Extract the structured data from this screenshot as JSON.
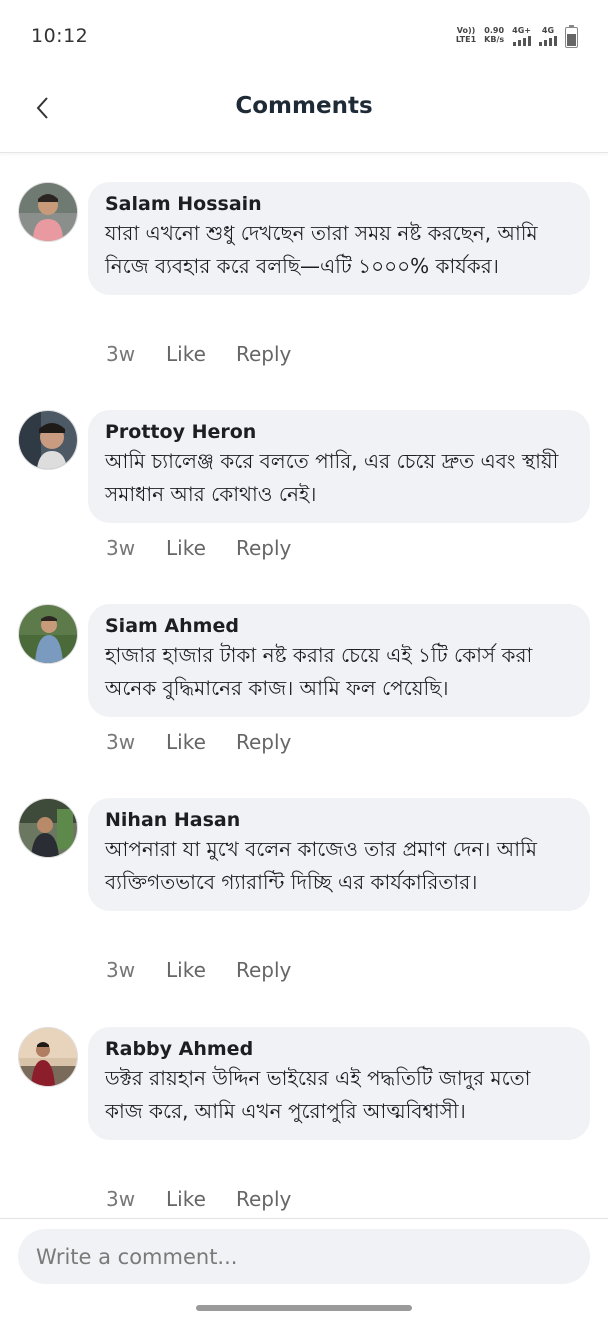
{
  "status_bar": {
    "time": "10:12",
    "volte_top": "Vo))",
    "volte_bottom": "LTE1",
    "speed_value": "0.90",
    "speed_unit": "KB/s",
    "network1": "4G+",
    "network2": "4G"
  },
  "header": {
    "title": "Comments",
    "back_icon": "chevron-left-icon"
  },
  "comments": [
    {
      "author": "Salam Hossain",
      "text": "যারা এখনো শুধু দেখছেন তারা সময় নষ্ট করছেন, আমি নিজে ব্যবহার করে বলছি—এটি ১০০০% কার্যকর।",
      "time": "3w",
      "like": "Like",
      "reply": "Reply"
    },
    {
      "author": "Prottoy Heron",
      "text": "আমি চ্যালেঞ্জ করে বলতে পারি, এর চেয়ে দ্রুত এবং স্থায়ী সমাধান আর কোথাও নেই।",
      "time": "3w",
      "like": "Like",
      "reply": "Reply"
    },
    {
      "author": "Siam Ahmed",
      "text": "হাজার হাজার টাকা নষ্ট করার চেয়ে এই ১টি কোর্স করা অনেক বুদ্ধিমানের কাজ। আমি ফল পেয়েছি।",
      "time": "3w",
      "like": "Like",
      "reply": "Reply"
    },
    {
      "author": "Nihan Hasan",
      "text": "আপনারা যা মুখে বলেন কাজেও তার প্রমাণ দেন। আমি ব্যক্তিগতভাবে গ্যারান্টি দিচ্ছি এর কার্যকারিতার।",
      "time": "3w",
      "like": "Like",
      "reply": "Reply"
    },
    {
      "author": "Rabby Ahmed",
      "text": "ডক্টর রায়হান উদ্দিন ভাইয়ের এই পদ্ধতিটি জাদুর মতো কাজ করে, আমি এখন পুরোপুরি আত্মবিশ্বাসী।",
      "time": "3w",
      "like": "Like",
      "reply": "Reply"
    }
  ],
  "composer": {
    "placeholder": "Write a comment..."
  },
  "colors": {
    "bubble": "#f0f2f5",
    "title": "#1f2a37",
    "muted": "#666666"
  }
}
